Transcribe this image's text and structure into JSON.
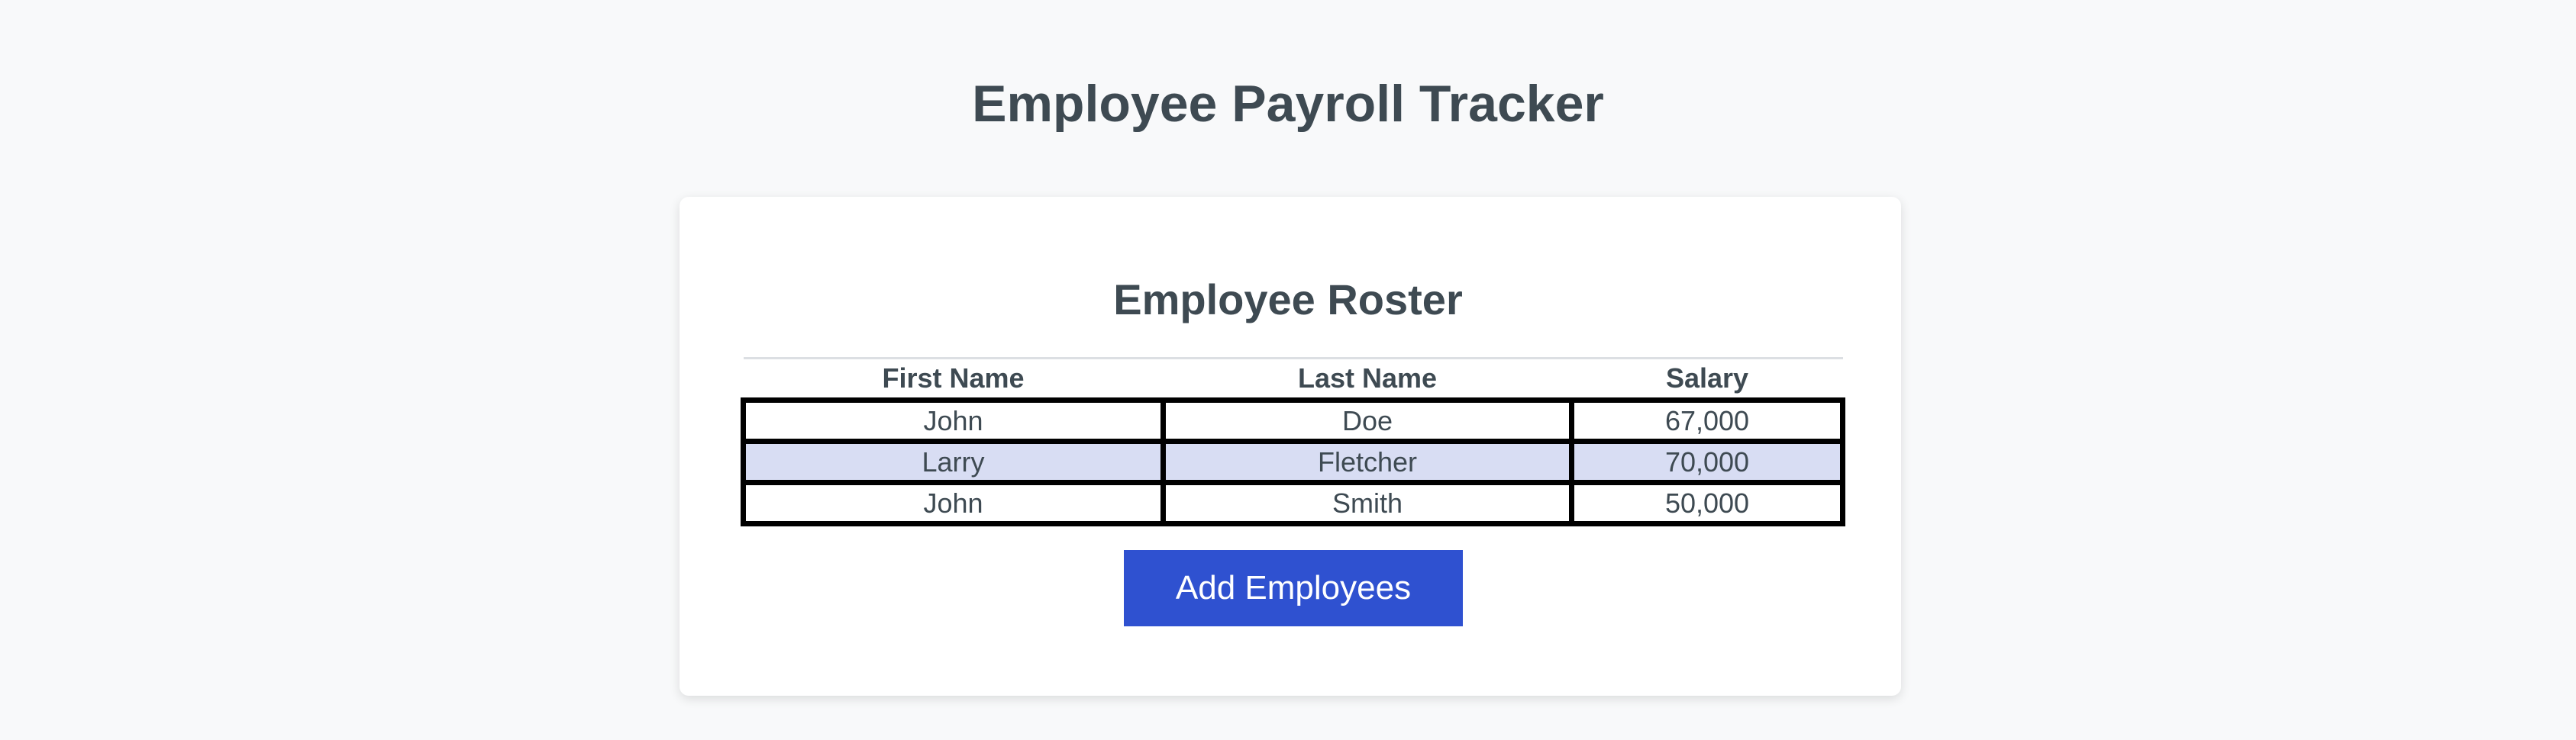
{
  "header": {
    "title": "Employee Payroll Tracker"
  },
  "roster": {
    "title": "Employee Roster",
    "columns": [
      "First Name",
      "Last Name",
      "Salary"
    ],
    "rows": [
      {
        "first_name": "John",
        "last_name": "Doe",
        "salary": "67,000"
      },
      {
        "first_name": "Larry",
        "last_name": "Fletcher",
        "salary": "70,000"
      },
      {
        "first_name": "John",
        "last_name": "Smith",
        "salary": "50,000"
      }
    ],
    "alt_row_color": "#d8ddf3"
  },
  "actions": {
    "add_label": "Add Employees",
    "button_color": "#2f51d0"
  },
  "colors": {
    "background": "#f8f9fa",
    "text": "#3e4a52",
    "card": "#ffffff"
  }
}
